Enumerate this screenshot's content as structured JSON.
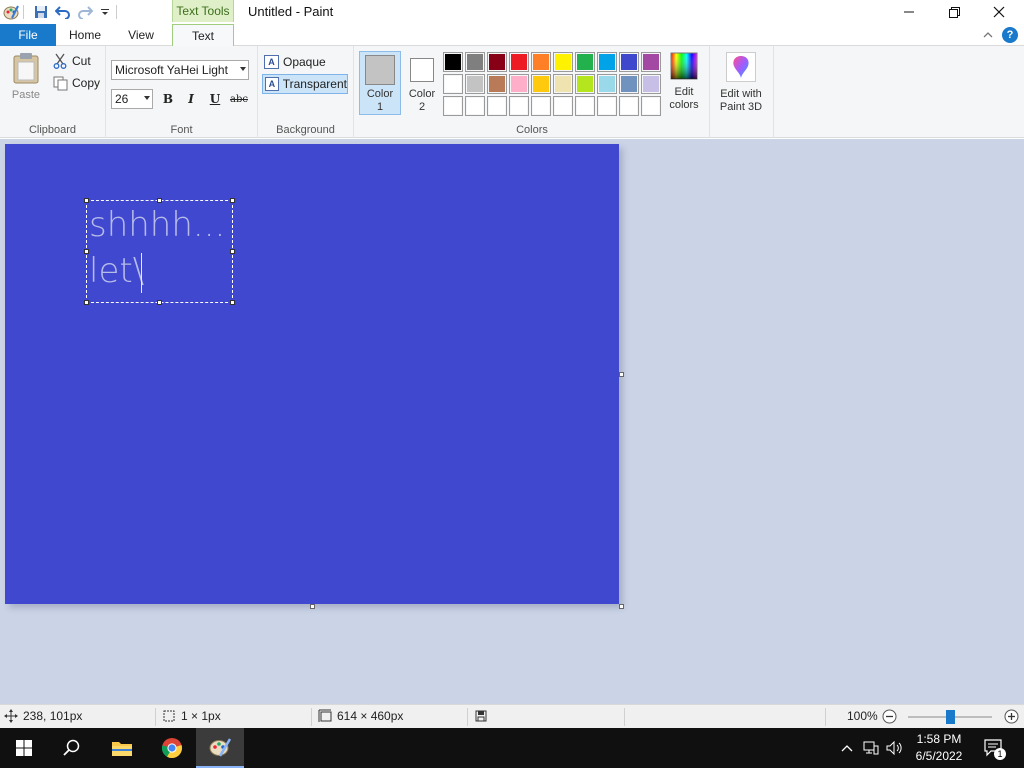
{
  "window": {
    "title": "Untitled - Paint",
    "contextual_tab_group": "Text Tools"
  },
  "tabs": {
    "file": "File",
    "home": "Home",
    "view": "View",
    "text": "Text"
  },
  "ribbon": {
    "clipboard": {
      "label": "Clipboard",
      "paste": "Paste",
      "cut": "Cut",
      "copy": "Copy"
    },
    "font": {
      "label": "Font",
      "family": "Microsoft YaHei Light",
      "size": "26",
      "bold": "B",
      "italic": "I",
      "underline": "U",
      "strikethrough": "abc"
    },
    "background": {
      "label": "Background",
      "opaque": "Opaque",
      "transparent": "Transparent",
      "selected": "Transparent"
    },
    "colors": {
      "label": "Colors",
      "color1_label_line1": "Color",
      "color1_label_line2": "1",
      "color2_label_line1": "Color",
      "color2_label_line2": "2",
      "color1_value": "#c3c3c3",
      "color2_value": "#ffffff",
      "edit_colors_line1": "Edit",
      "edit_colors_line2": "colors",
      "palette_row1": [
        "#000000",
        "#7f7f7f",
        "#880015",
        "#ed1c24",
        "#ff7f27",
        "#fff200",
        "#22b14c",
        "#00a2e8",
        "#3f48cc",
        "#a349a4"
      ],
      "palette_row2": [
        "#ffffff",
        "#c3c3c3",
        "#b97a57",
        "#ffaec9",
        "#ffc90e",
        "#efe4b0",
        "#b5e61d",
        "#99d9ea",
        "#7092be",
        "#c8bfe7"
      ],
      "palette_row3": [
        "#ffffff",
        "#ffffff",
        "#ffffff",
        "#ffffff",
        "#ffffff",
        "#ffffff",
        "#ffffff",
        "#ffffff",
        "#ffffff",
        "#ffffff"
      ]
    },
    "paint3d": {
      "line1": "Edit with",
      "line2": "Paint 3D"
    }
  },
  "canvas": {
    "background_color": "#4048d0",
    "text_line1": "shhhh...",
    "text_line2": "let\\"
  },
  "statusbar": {
    "cursor_position": "238, 101px",
    "selection_size": "1 × 1px",
    "image_size": "614 × 460px",
    "zoom": "100%",
    "zoom_percent": 100
  },
  "taskbar": {
    "time": "1:58 PM",
    "date": "6/5/2022",
    "notification_count": "1"
  }
}
